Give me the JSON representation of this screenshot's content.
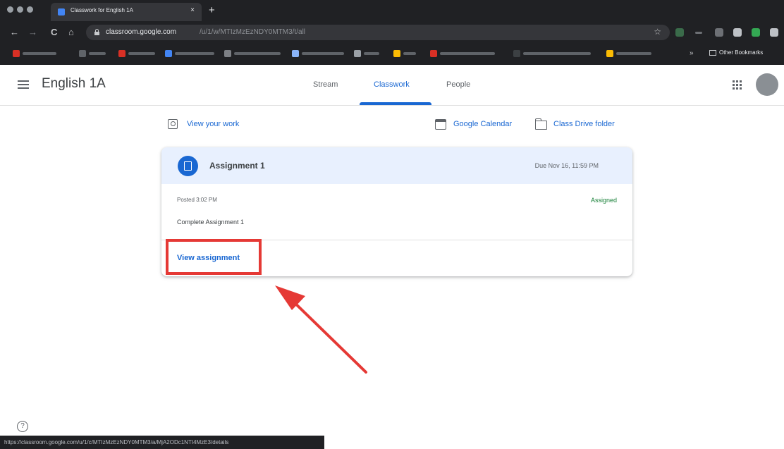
{
  "browser": {
    "tab_title": "Classwork for English 1A",
    "tab_close": "×",
    "new_tab": "+",
    "url_host": "classroom.google.com",
    "url_path": "/u/1/w/MTIzMzEzNDY0MTM3/t/all",
    "other_bookmarks": "Other Bookmarks",
    "nav_back": "←",
    "nav_forward": "→",
    "nav_reload": "C",
    "nav_home": "⌂",
    "bookmark_star": "☆",
    "bookmarks_more": "»"
  },
  "header": {
    "class_title": "English 1A",
    "tabs": [
      {
        "label": "Stream"
      },
      {
        "label": "Classwork"
      },
      {
        "label": "People"
      }
    ],
    "active_tab": "Classwork"
  },
  "links": {
    "view_work": "View your work",
    "calendar": "Google Calendar",
    "drive_folder": "Class Drive folder"
  },
  "assignment": {
    "title": "Assignment 1",
    "due": "Due Nov 16, 11:59 PM",
    "posted": "Posted 3:02 PM",
    "status": "Assigned",
    "instructions": "Complete Assignment 1",
    "action": "View assignment"
  },
  "help_glyph": "?",
  "status_url": "https://classroom.google.com/u/1/c/MTIzMzEzNDY0MTM3/a/MjA2ODc1NTI4MzE3/details",
  "colors": {
    "accent": "#1967d2",
    "card_header": "#e8f0fe",
    "status_green": "#188038",
    "annotation_red": "#e53935"
  }
}
